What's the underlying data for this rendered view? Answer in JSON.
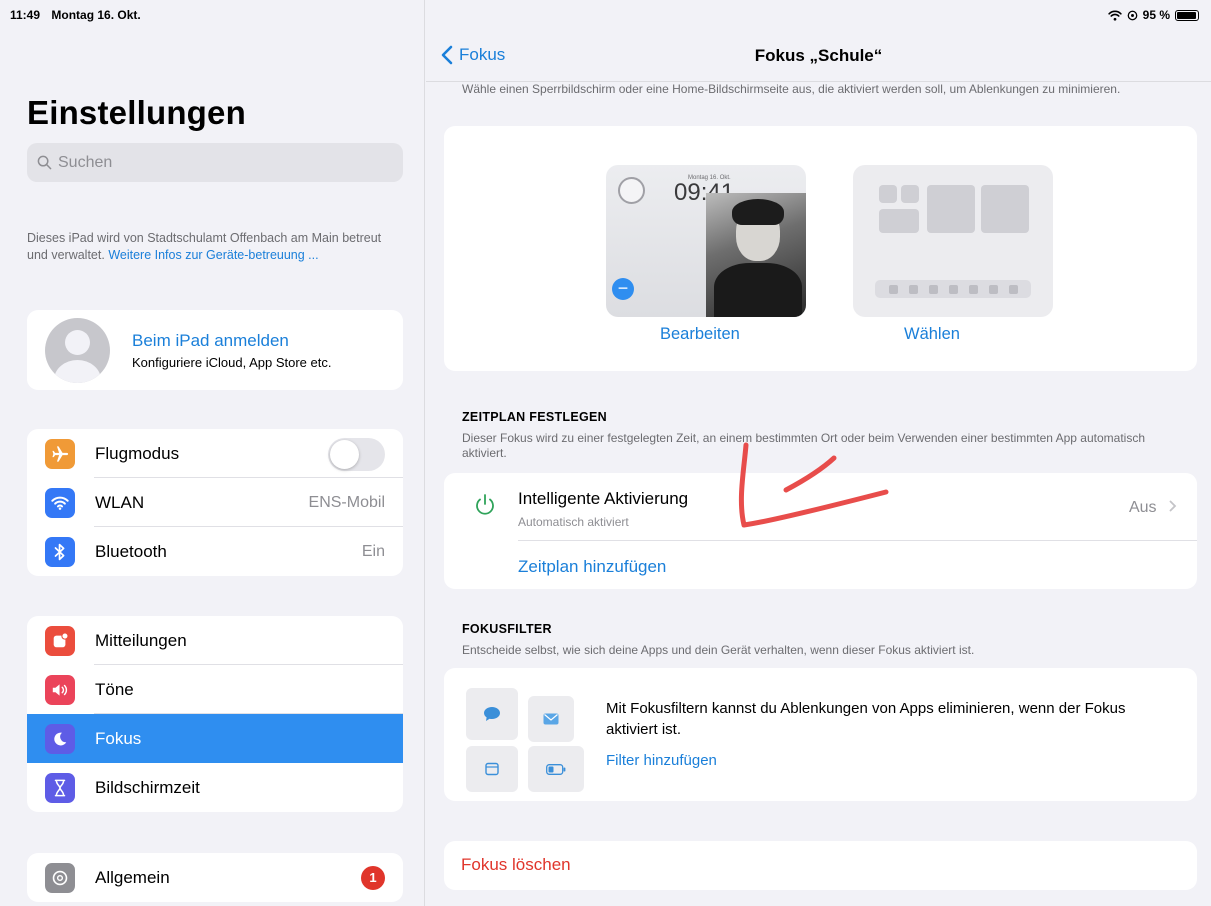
{
  "status_bar": {
    "time": "11:49",
    "date": "Montag 16. Okt.",
    "battery_text": "95 %"
  },
  "sidebar": {
    "title": "Einstellungen",
    "search_placeholder": "Suchen",
    "managed_text": "Dieses iPad wird von Stadtschulamt Offenbach am Main betreut und verwaltet.",
    "managed_link": "Weitere Infos zur Geräte-betreuung ...",
    "account_title": "Beim iPad anmelden",
    "account_subtitle": "Konfiguriere iCloud, App Store etc.",
    "connectivity": [
      {
        "label": "Flugmodus",
        "icon": "airplane-icon",
        "color": "#f09a37"
      },
      {
        "label": "WLAN",
        "value": "ENS-Mobil",
        "icon": "wifi-icon",
        "color": "#3478f6"
      },
      {
        "label": "Bluetooth",
        "value": "Ein",
        "icon": "bluetooth-icon",
        "color": "#3478f6"
      }
    ],
    "notifications": [
      {
        "label": "Mitteilungen",
        "icon": "notifications-icon",
        "color": "#eb4d3d"
      },
      {
        "label": "Töne",
        "icon": "sound-icon",
        "color": "#eb445a"
      },
      {
        "label": "Fokus",
        "icon": "moon-icon",
        "color": "#5e5ce6",
        "selected": true
      },
      {
        "label": "Bildschirmzeit",
        "icon": "hourglass-icon",
        "color": "#5e5ce6"
      }
    ],
    "general": [
      {
        "label": "Allgemein",
        "icon": "gear-icon",
        "color": "#8e8e93",
        "badge": "1"
      }
    ]
  },
  "detail": {
    "back_label": "Fokus",
    "nav_title": "Fokus „Schule“",
    "intro_text": "Wähle einen Sperrbildschirm oder eine Home-Bildschirmseite aus, die aktiviert werden soll, um Ablenkungen zu minimieren.",
    "lock_time": "09:41",
    "lock_date": "Montag 16. Okt.",
    "edit_label": "Bearbeiten",
    "choose_label": "Wählen",
    "schedule_header": "ZEITPLAN FESTLEGEN",
    "schedule_desc": "Dieser Fokus wird zu einer festgelegten Zeit, an einem bestimmten Ort oder beim Verwenden einer bestimmten App automatisch aktiviert.",
    "smart_title": "Intelligente Aktivierung",
    "smart_subtitle": "Automatisch aktiviert",
    "smart_value": "Aus",
    "add_schedule": "Zeitplan hinzufügen",
    "filter_header": "FOKUSFILTER",
    "filter_desc": "Entscheide selbst, wie sich deine Apps und dein Gerät verhalten, wenn dieser Fokus aktiviert ist.",
    "filter_text": "Mit Fokusfiltern kannst du Ablenkungen von Apps eliminieren, wenn der Fokus aktiviert ist.",
    "filter_link": "Filter hinzufügen",
    "delete_label": "Fokus löschen"
  }
}
